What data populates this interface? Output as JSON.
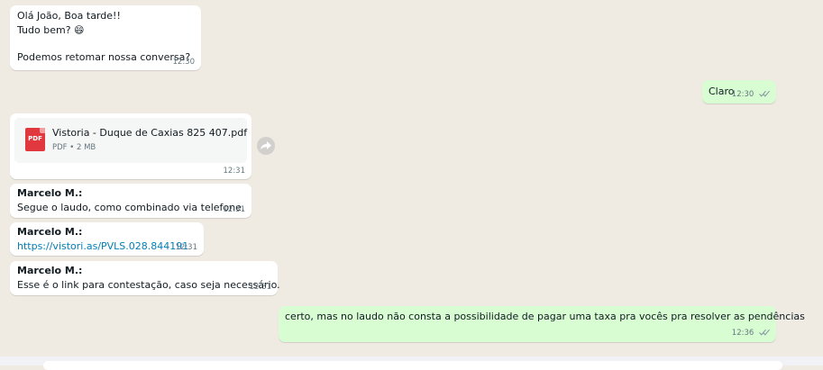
{
  "messages": {
    "m1": {
      "line1": "Olá João, Boa tarde!!",
      "line2": "Tudo bem?",
      "emoji": "😄",
      "line3": "Podemos retomar nossa conversa?",
      "time": "12:30"
    },
    "m2": {
      "text": "Claro",
      "time": "12:30"
    },
    "m3": {
      "file_name": "Vistoria - Duque de Caxias 825 407.pdf",
      "file_meta": "PDF • 2 MB",
      "icon_label": "PDF",
      "time": "12:31"
    },
    "m4": {
      "sender": "Marcelo M.:",
      "text": "Segue o laudo, como combinado via telefone.",
      "time": "12:31"
    },
    "m5": {
      "sender": "Marcelo M.:",
      "link": "https://vistori.as/PVLS.028.844191",
      "time": "12:31"
    },
    "m6": {
      "sender": "Marcelo M.:",
      "text": "Esse é o link para contestação, caso seja necessário.",
      "time": "12:31"
    },
    "m7": {
      "text": "certo, mas no laudo não consta a possibilidade de pagar uma taxa pra vocês pra resolver as pendências",
      "time": "12:36"
    }
  },
  "icons": {
    "forward": "forward-icon",
    "ticks": "double-check-icon",
    "file": "pdf-file-icon"
  },
  "colors": {
    "background": "#efeae2",
    "incoming": "#ffffff",
    "outgoing": "#d9fdd3",
    "link": "#027eb5",
    "pdf": "#e0383e"
  }
}
